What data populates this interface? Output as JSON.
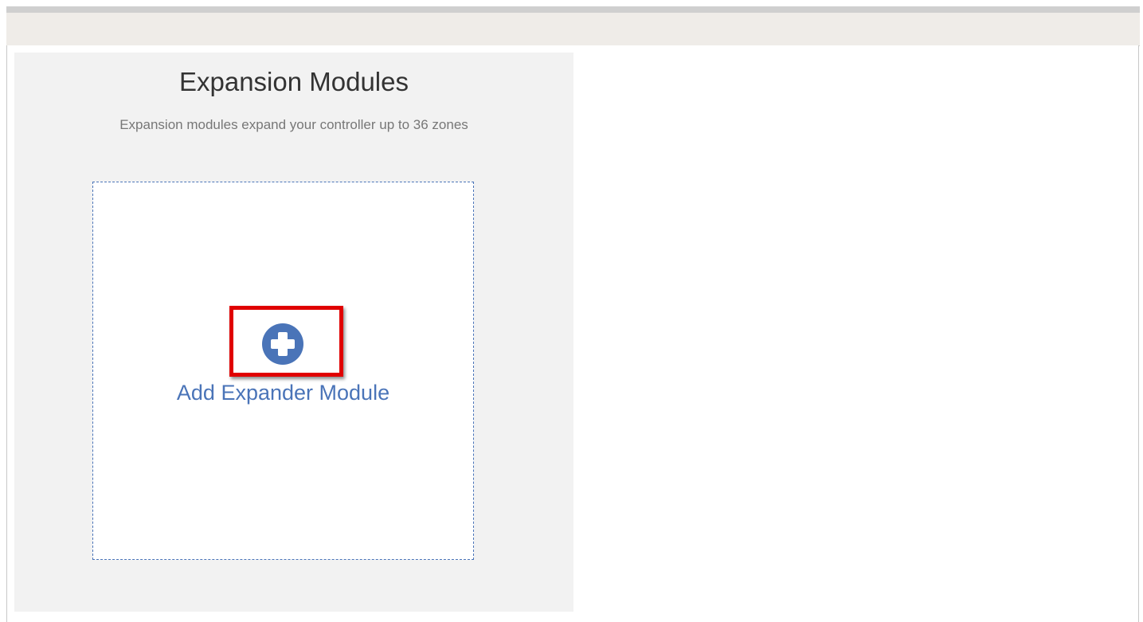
{
  "panel": {
    "title": "Expansion Modules",
    "subtitle": "Expansion modules expand your controller up to 36 zones"
  },
  "add_card": {
    "label": "Add Expander Module",
    "icon": "plus-circle-icon"
  },
  "colors": {
    "accent": "#4a74b8",
    "highlight": "#e00000",
    "panel_bg": "#f2f2f2",
    "header_bg": "#efece8"
  }
}
